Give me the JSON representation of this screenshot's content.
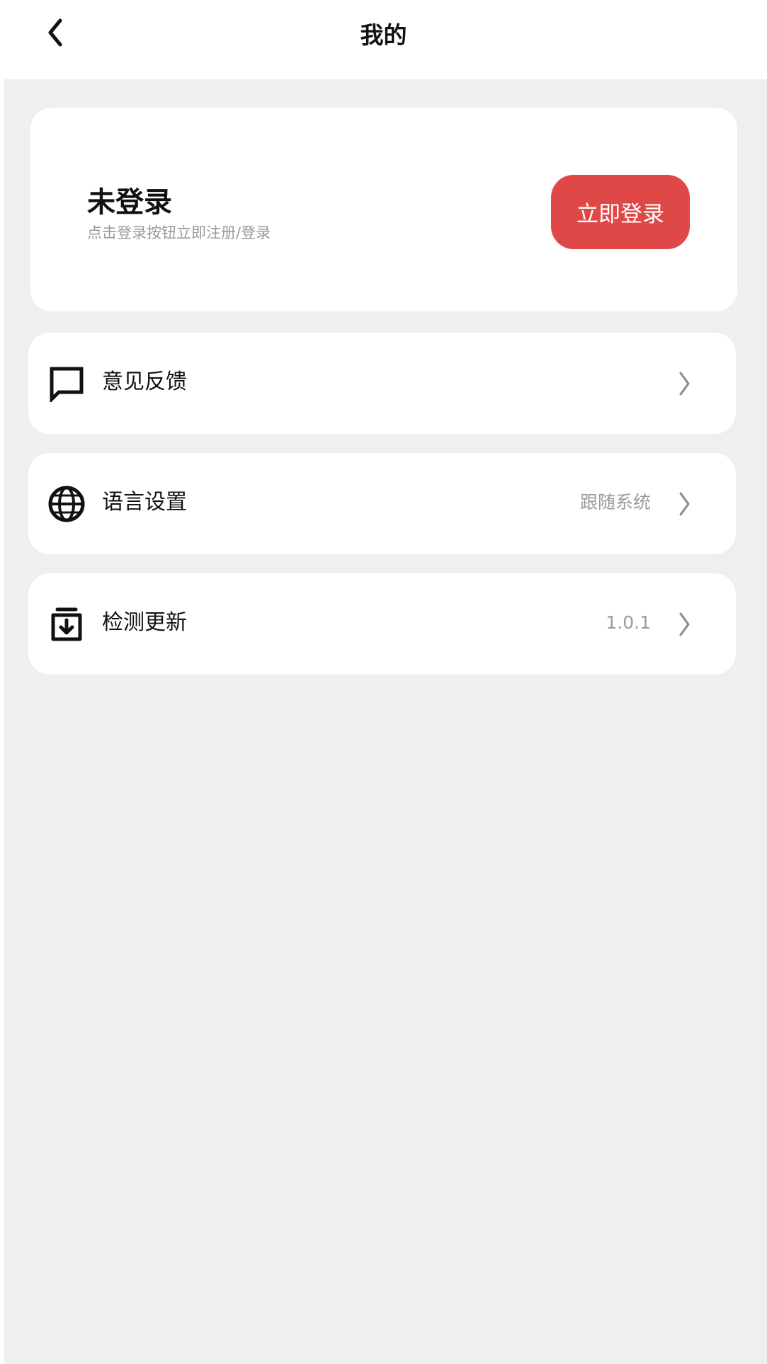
{
  "header": {
    "back_icon": "chevron-left-icon",
    "title": "我的"
  },
  "login_card": {
    "title": "未登录",
    "subtitle": "点击登录按钮立即注册/登录",
    "button_label": "立即登录",
    "button_color": "#e04848"
  },
  "menu": {
    "items": [
      {
        "icon": "chat-bubble-icon",
        "label": "意见反馈",
        "value": ""
      },
      {
        "icon": "globe-icon",
        "label": "语言设置",
        "value": "跟随系统"
      },
      {
        "icon": "download-box-icon",
        "label": "检测更新",
        "value": "1.0.1"
      }
    ]
  },
  "colors": {
    "background": "#efefef",
    "card": "#ffffff",
    "accent": "#e04848",
    "secondary_text": "#9a9a9a"
  }
}
